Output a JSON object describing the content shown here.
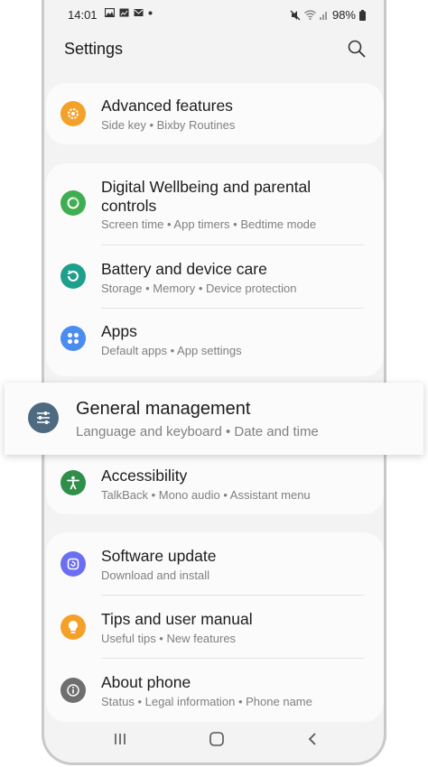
{
  "status_bar": {
    "time": "14:01",
    "battery": "98%",
    "notification_icons": [
      "image-icon",
      "image-icon",
      "mail-icon",
      "dot-icon"
    ],
    "system_icons": [
      "mute-icon",
      "wifi-icon",
      "signal-icon",
      "battery-icon"
    ]
  },
  "header": {
    "title": "Settings"
  },
  "items": {
    "advanced": {
      "title": "Advanced features",
      "sub": "Side key  •  Bixby Routines",
      "icon": "gear-icon",
      "color": "#f4a12a"
    },
    "wellbeing": {
      "title": "Digital Wellbeing and parental\ncontrols",
      "sub": "Screen time  •  App timers  •  Bedtime mode",
      "icon": "wellbeing-icon",
      "color": "#3fae52"
    },
    "battery": {
      "title": "Battery and device care",
      "sub": "Storage  •  Memory  •  Device protection",
      "icon": "device-care-icon",
      "color": "#1fa08c"
    },
    "apps": {
      "title": "Apps",
      "sub": "Default apps  •  App settings",
      "icon": "apps-icon",
      "color": "#4a8cf0"
    },
    "general": {
      "title": "General management",
      "sub": "Language and keyboard  •  Date and time",
      "icon": "sliders-icon",
      "color": "#4e6a80"
    },
    "accessibility": {
      "title": "Accessibility",
      "sub": "TalkBack  •  Mono audio  •  Assistant menu",
      "icon": "accessibility-icon",
      "color": "#2f8f4a"
    },
    "software": {
      "title": "Software update",
      "sub": "Download and install",
      "icon": "update-icon",
      "color": "#6b6ef0"
    },
    "tips": {
      "title": "Tips and user manual",
      "sub": "Useful tips  •  New features",
      "icon": "lightbulb-icon",
      "color": "#f4a12a"
    },
    "about": {
      "title": "About phone",
      "sub": "Status  •  Legal information  •  Phone name",
      "icon": "info-icon",
      "color": "#6f6f6f"
    }
  },
  "navigation": [
    "recents-button",
    "home-button",
    "back-button"
  ]
}
